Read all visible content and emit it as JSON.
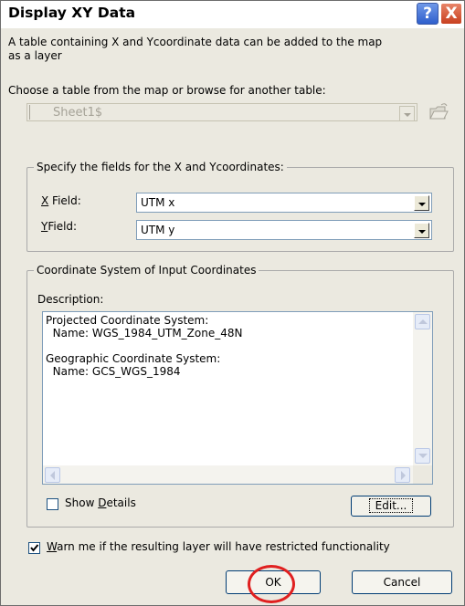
{
  "window": {
    "title": "Display XY Data",
    "help_button": "?",
    "close_button": "X"
  },
  "intro": {
    "line1": "A table containing X and Ycoordinate data can be added to the map",
    "line2": "as a layer"
  },
  "choose_table": {
    "label": "Choose a table from the map or browse for another table:",
    "value": "Sheet1$"
  },
  "fields_group": {
    "label": "Specify the fields for the X and Ycoordinates:",
    "x_label_key": "X",
    "x_label_rest": " Field:",
    "x_value": "UTM x",
    "y_label_key": "Y",
    "y_label_rest": "Field:",
    "y_value": "UTM y"
  },
  "coord_group": {
    "label": "Coordinate System of Input Coordinates",
    "description_label": "Description:",
    "description_lines": [
      "Projected Coordinate System:",
      "  Name: WGS_1984_UTM_Zone_48N",
      "",
      "Geographic Coordinate System:",
      "  Name: GCS_WGS_1984"
    ],
    "show_details_prefix": "Show ",
    "show_details_key": "D",
    "show_details_rest": "etails",
    "edit_button": "Edit..."
  },
  "warn": {
    "key": "W",
    "rest": "arn me if the resulting layer will have restricted functionality",
    "checked": true
  },
  "buttons": {
    "ok": "OK",
    "cancel": "Cancel"
  },
  "highlight_color": "#e02020"
}
